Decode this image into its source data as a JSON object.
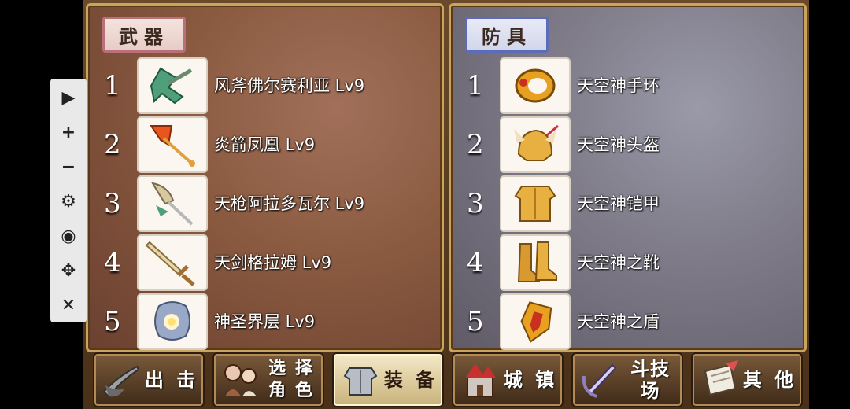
{
  "weapons": {
    "title": "武器",
    "items": [
      {
        "num": "1",
        "name": "风斧佛尔赛利亚 Lv9",
        "icon": "green-axe-icon"
      },
      {
        "num": "2",
        "name": "炎箭凤凰 Lv9",
        "icon": "fire-arrow-icon"
      },
      {
        "num": "3",
        "name": "天枪阿拉多瓦尔 Lv9",
        "icon": "sky-spear-icon"
      },
      {
        "num": "4",
        "name": "天剑格拉姆 Lv9",
        "icon": "sky-sword-icon"
      },
      {
        "num": "5",
        "name": "神圣界层 Lv9",
        "icon": "holy-orb-icon"
      }
    ]
  },
  "armor": {
    "title": "防具",
    "items": [
      {
        "num": "1",
        "name": "天空神手环",
        "icon": "bracelet-icon"
      },
      {
        "num": "2",
        "name": "天空神头盔",
        "icon": "helmet-icon"
      },
      {
        "num": "3",
        "name": "天空神铠甲",
        "icon": "armor-icon"
      },
      {
        "num": "4",
        "name": "天空神之靴",
        "icon": "boots-icon"
      },
      {
        "num": "5",
        "name": "天空神之盾",
        "icon": "shield-icon"
      }
    ]
  },
  "toolbar": {
    "play": "▶",
    "zoom_in": "+",
    "zoom_out": "−",
    "settings": "⚙",
    "view": "◉",
    "move": "✥",
    "close": "✕"
  },
  "nav": {
    "sortie": "出 击",
    "select_line1": "选 择",
    "select_line2": "角 色",
    "equip": "装 备",
    "town": "城 镇",
    "arena": "斗技场",
    "other": "其 他"
  },
  "colors": {
    "weapon_tag_border": "#b9707a",
    "armor_tag_border": "#5c6cb8",
    "panel_border": "#c9a45c"
  }
}
